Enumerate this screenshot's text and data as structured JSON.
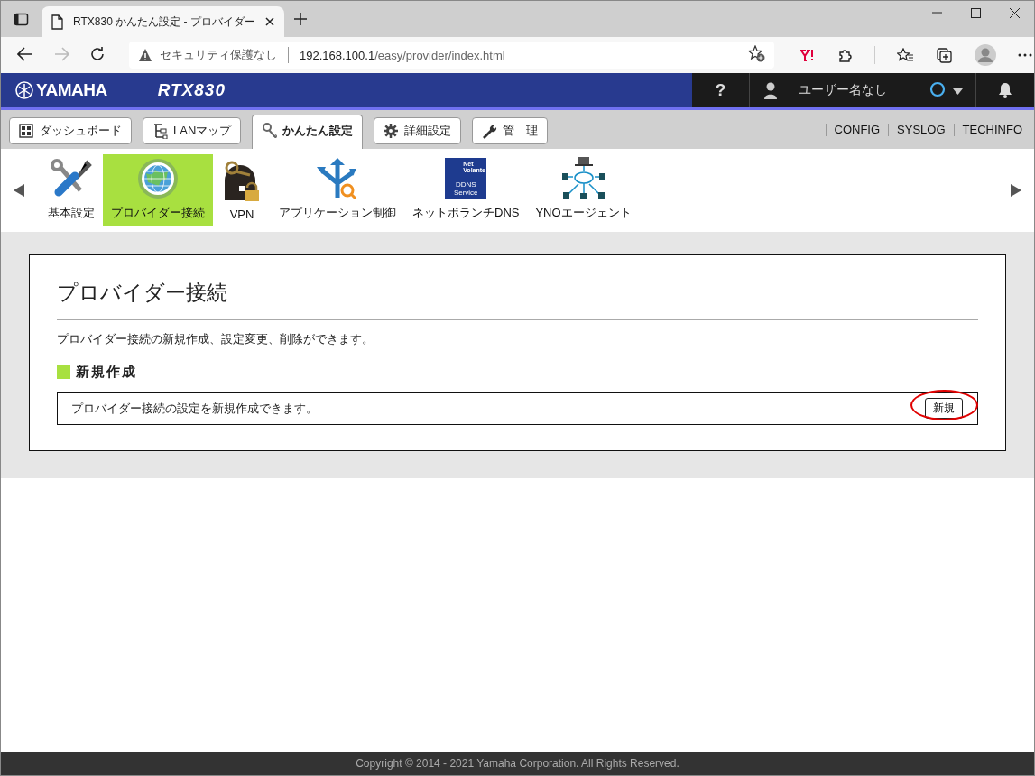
{
  "browser": {
    "tab_title": "RTX830 かんたん設定 - プロバイダー",
    "security_label": "セキュリティ保護なし",
    "url_host": "192.168.100.1",
    "url_path": "/easy/provider/index.html"
  },
  "header": {
    "brand": "YAMAHA",
    "model": "RTX830",
    "help": "?",
    "user": "ユーザー名なし"
  },
  "tabs": [
    {
      "label": "ダッシュボード",
      "selected": false
    },
    {
      "label": "LANマップ",
      "selected": false
    },
    {
      "label": "かんたん設定",
      "selected": true
    },
    {
      "label": "詳細設定",
      "selected": false
    },
    {
      "label": "管　理",
      "selected": false
    }
  ],
  "links": [
    "CONFIG",
    "SYSLOG",
    "TECHINFO"
  ],
  "menu": [
    {
      "label": "基本設定",
      "selected": false
    },
    {
      "label": "プロバイダー接続",
      "selected": true
    },
    {
      "label": "VPN",
      "selected": false
    },
    {
      "label": "アプリケーション制御",
      "selected": false
    },
    {
      "label": "ネットボランチDNS",
      "selected": false,
      "badge_top": "Net Volante",
      "badge_bottom": "DDNS Service"
    },
    {
      "label": "YNOエージェント",
      "selected": false
    }
  ],
  "page": {
    "title": "プロバイダー接続",
    "description": "プロバイダー接続の新規作成、設定変更、削除ができます。",
    "section": "新規作成",
    "row_text": "プロバイダー接続の設定を新規作成できます。",
    "button": {
      "label": "新規",
      "highlighted": true
    }
  },
  "footer": "Copyright © 2014 - 2021 Yamaha Corporation. All Rights Reserved."
}
